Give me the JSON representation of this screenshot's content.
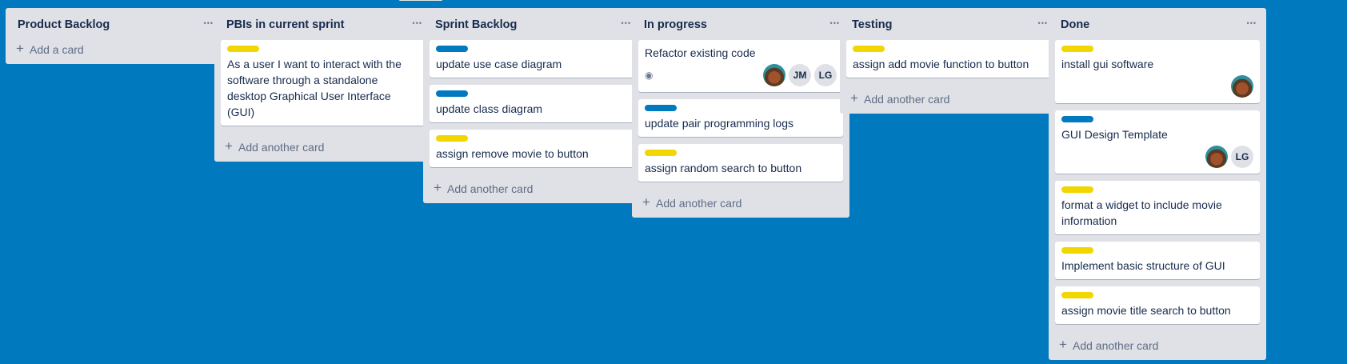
{
  "colors": {
    "board_bg": "#0079bf",
    "label_yellow": "#f2d600",
    "label_blue": "#0079bf"
  },
  "lists": [
    {
      "title": "Product Backlog",
      "menu_icon": "ellipsis-icon",
      "cards": [],
      "add_label": "Add a card"
    },
    {
      "title": "PBIs in current sprint",
      "menu_icon": "ellipsis-icon",
      "cards": [
        {
          "label": "yellow",
          "text": "As a user I want to interact with the software through a standalone desktop Graphical User Interface (GUI)"
        }
      ],
      "add_label": "Add another card"
    },
    {
      "title": "Sprint Backlog",
      "menu_icon": "ellipsis-icon",
      "cards": [
        {
          "label": "blue",
          "text": "update use case diagram"
        },
        {
          "label": "blue",
          "text": "update class diagram"
        },
        {
          "label": "yellow",
          "text": "assign remove movie to button"
        }
      ],
      "add_label": "Add another card"
    },
    {
      "title": "In progress",
      "menu_icon": "ellipsis-icon",
      "cards": [
        {
          "text": "Refactor existing code",
          "watch": true,
          "members": [
            "photo",
            "JM",
            "LG"
          ]
        },
        {
          "label": "blue",
          "text": "update pair programming logs"
        },
        {
          "label": "yellow",
          "text": "assign random search to button"
        }
      ],
      "add_label": "Add another card"
    },
    {
      "title": "Testing",
      "menu_icon": "ellipsis-icon",
      "cards": [
        {
          "label": "yellow",
          "text": "assign add movie function to button"
        }
      ],
      "add_label": "Add another card"
    },
    {
      "title": "Done",
      "menu_icon": "ellipsis-icon",
      "cards": [
        {
          "label": "yellow",
          "text": "install gui software",
          "members": [
            "photo"
          ]
        },
        {
          "label": "blue",
          "text": "GUI Design Template",
          "members": [
            "photo",
            "LG"
          ]
        },
        {
          "label": "yellow",
          "text": "format a widget to include movie information"
        },
        {
          "label": "yellow",
          "text": "Implement basic structure of GUI"
        },
        {
          "label": "yellow",
          "text": "assign movie title search to button"
        }
      ],
      "add_label": "Add another card"
    }
  ]
}
